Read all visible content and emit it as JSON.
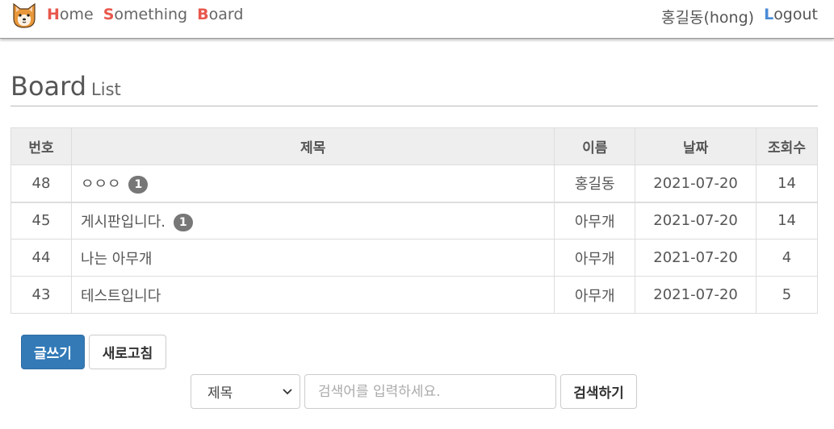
{
  "nav": {
    "logo_icon": "shiba-dog-icon",
    "left": [
      {
        "cap": "H",
        "rest": "ome"
      },
      {
        "cap": "S",
        "rest": "omething"
      },
      {
        "cap": "B",
        "rest": "oard"
      }
    ],
    "user": "홍길동(hong)",
    "logout": {
      "cap": "L",
      "rest": "ogout"
    }
  },
  "page": {
    "title": "Board",
    "subtitle": "List"
  },
  "table": {
    "headers": [
      "번호",
      "제목",
      "이름",
      "날짜",
      "조회수"
    ],
    "rows": [
      {
        "no": "48",
        "subject": "ㅇㅇㅇ",
        "badge": "1",
        "name": "홍길동",
        "date": "2021-07-20",
        "views": "14"
      },
      {
        "no": "45",
        "subject": "게시판입니다.",
        "badge": "1",
        "name": "아무개",
        "date": "2021-07-20",
        "views": "14"
      },
      {
        "no": "44",
        "subject": "나는 아무개",
        "badge": "",
        "name": "아무개",
        "date": "2021-07-20",
        "views": "4"
      },
      {
        "no": "43",
        "subject": "테스트입니다",
        "badge": "",
        "name": "아무개",
        "date": "2021-07-20",
        "views": "5"
      }
    ]
  },
  "actions": {
    "write": "글쓰기",
    "refresh": "새로고침"
  },
  "search": {
    "select_value": "제목",
    "placeholder": "검색어를 입력하세요.",
    "button": "검색하기"
  },
  "colors": {
    "primary": "#337ab7",
    "nav_cap": "#e8584c",
    "logout_cap": "#4a8bd6",
    "badge": "#777777"
  }
}
